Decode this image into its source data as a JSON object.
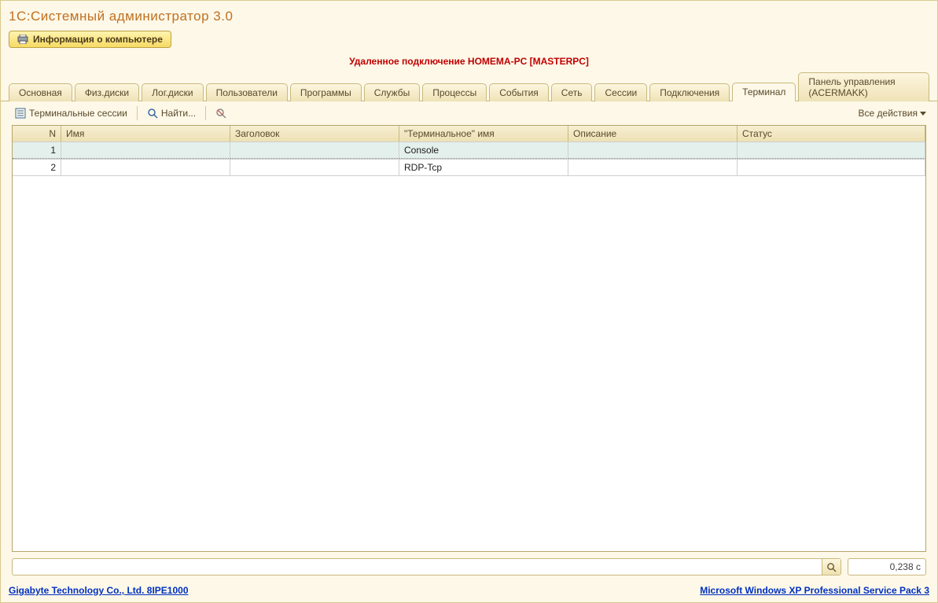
{
  "title": "1С:Системный администратор 3.0",
  "info_button": "Информация о компьютере",
  "remote_line": "Удаленное подключение HOMEMA-PC [MASTERPC]",
  "tabs": [
    "Основная",
    "Физ.диски",
    "Лог.диски",
    "Пользователи",
    "Программы",
    "Службы",
    "Процессы",
    "События",
    "Сеть",
    "Сессии",
    "Подключения",
    "Терминал",
    "Панель управления (ACERMAKK)"
  ],
  "active_tab_index": 11,
  "toolbar": {
    "terminal_sessions": "Терминальные сессии",
    "find": "Найти...",
    "all_actions": "Все действия"
  },
  "grid": {
    "columns": [
      "N",
      "Имя",
      "Заголовок",
      "\"Терминальное\" имя",
      "Описание",
      "Статус"
    ],
    "rows": [
      {
        "n": "1",
        "name": "",
        "header": "",
        "term": "Console",
        "desc": "",
        "status": ""
      },
      {
        "n": "2",
        "name": "",
        "header": "",
        "term": "RDP-Tcp",
        "desc": "",
        "status": ""
      }
    ],
    "selected_row_index": 0
  },
  "search_value": "",
  "timer": "0,238 с",
  "footer": {
    "left": "Gigabyte Technology Co., Ltd. 8IPE1000",
    "right": "Microsoft Windows XP Professional Service Pack 3"
  }
}
